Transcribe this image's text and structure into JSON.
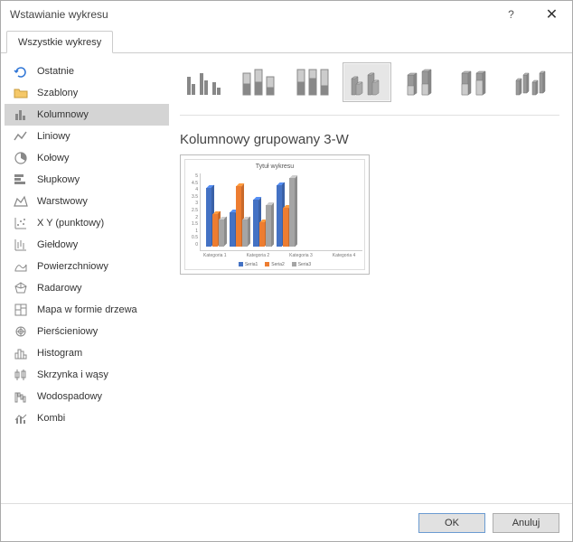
{
  "titlebar": {
    "title": "Wstawianie wykresu"
  },
  "tab": {
    "label": "Wszystkie wykresy"
  },
  "sidebar": {
    "items": [
      {
        "label": "Ostatnie"
      },
      {
        "label": "Szablony"
      },
      {
        "label": "Kolumnowy"
      },
      {
        "label": "Liniowy"
      },
      {
        "label": "Kołowy"
      },
      {
        "label": "Słupkowy"
      },
      {
        "label": "Warstwowy"
      },
      {
        "label": "X Y (punktowy)"
      },
      {
        "label": "Giełdowy"
      },
      {
        "label": "Powierzchniowy"
      },
      {
        "label": "Radarowy"
      },
      {
        "label": "Mapa w formie drzewa"
      },
      {
        "label": "Pierścieniowy"
      },
      {
        "label": "Histogram"
      },
      {
        "label": "Skrzynka i wąsy"
      },
      {
        "label": "Wodospadowy"
      },
      {
        "label": "Kombi"
      }
    ],
    "selected_index": 2
  },
  "content": {
    "subtype_title": "Kolumnowy grupowany 3-W",
    "selected_subtype_index": 3
  },
  "chart_data": {
    "type": "bar",
    "title": "Tytuł wykresu",
    "categories": [
      "Kategoria 1",
      "Kategoria 2",
      "Kategoria 3",
      "Kategoria 4"
    ],
    "series": [
      {
        "name": "Seria1",
        "values": [
          4.3,
          2.5,
          3.4,
          4.5
        ],
        "color": "#4472c4"
      },
      {
        "name": "Seria2",
        "values": [
          2.4,
          4.4,
          1.8,
          2.8
        ],
        "color": "#ed7d31"
      },
      {
        "name": "Seria3",
        "values": [
          2.0,
          2.0,
          3.0,
          5.0
        ],
        "color": "#a5a5a5"
      }
    ],
    "ylim": [
      0,
      5
    ],
    "yticks": [
      "5",
      "4.5",
      "4",
      "3.5",
      "3",
      "2.5",
      "2",
      "1.5",
      "1",
      "0.5",
      "0"
    ]
  },
  "footer": {
    "ok": "OK",
    "cancel": "Anuluj"
  }
}
